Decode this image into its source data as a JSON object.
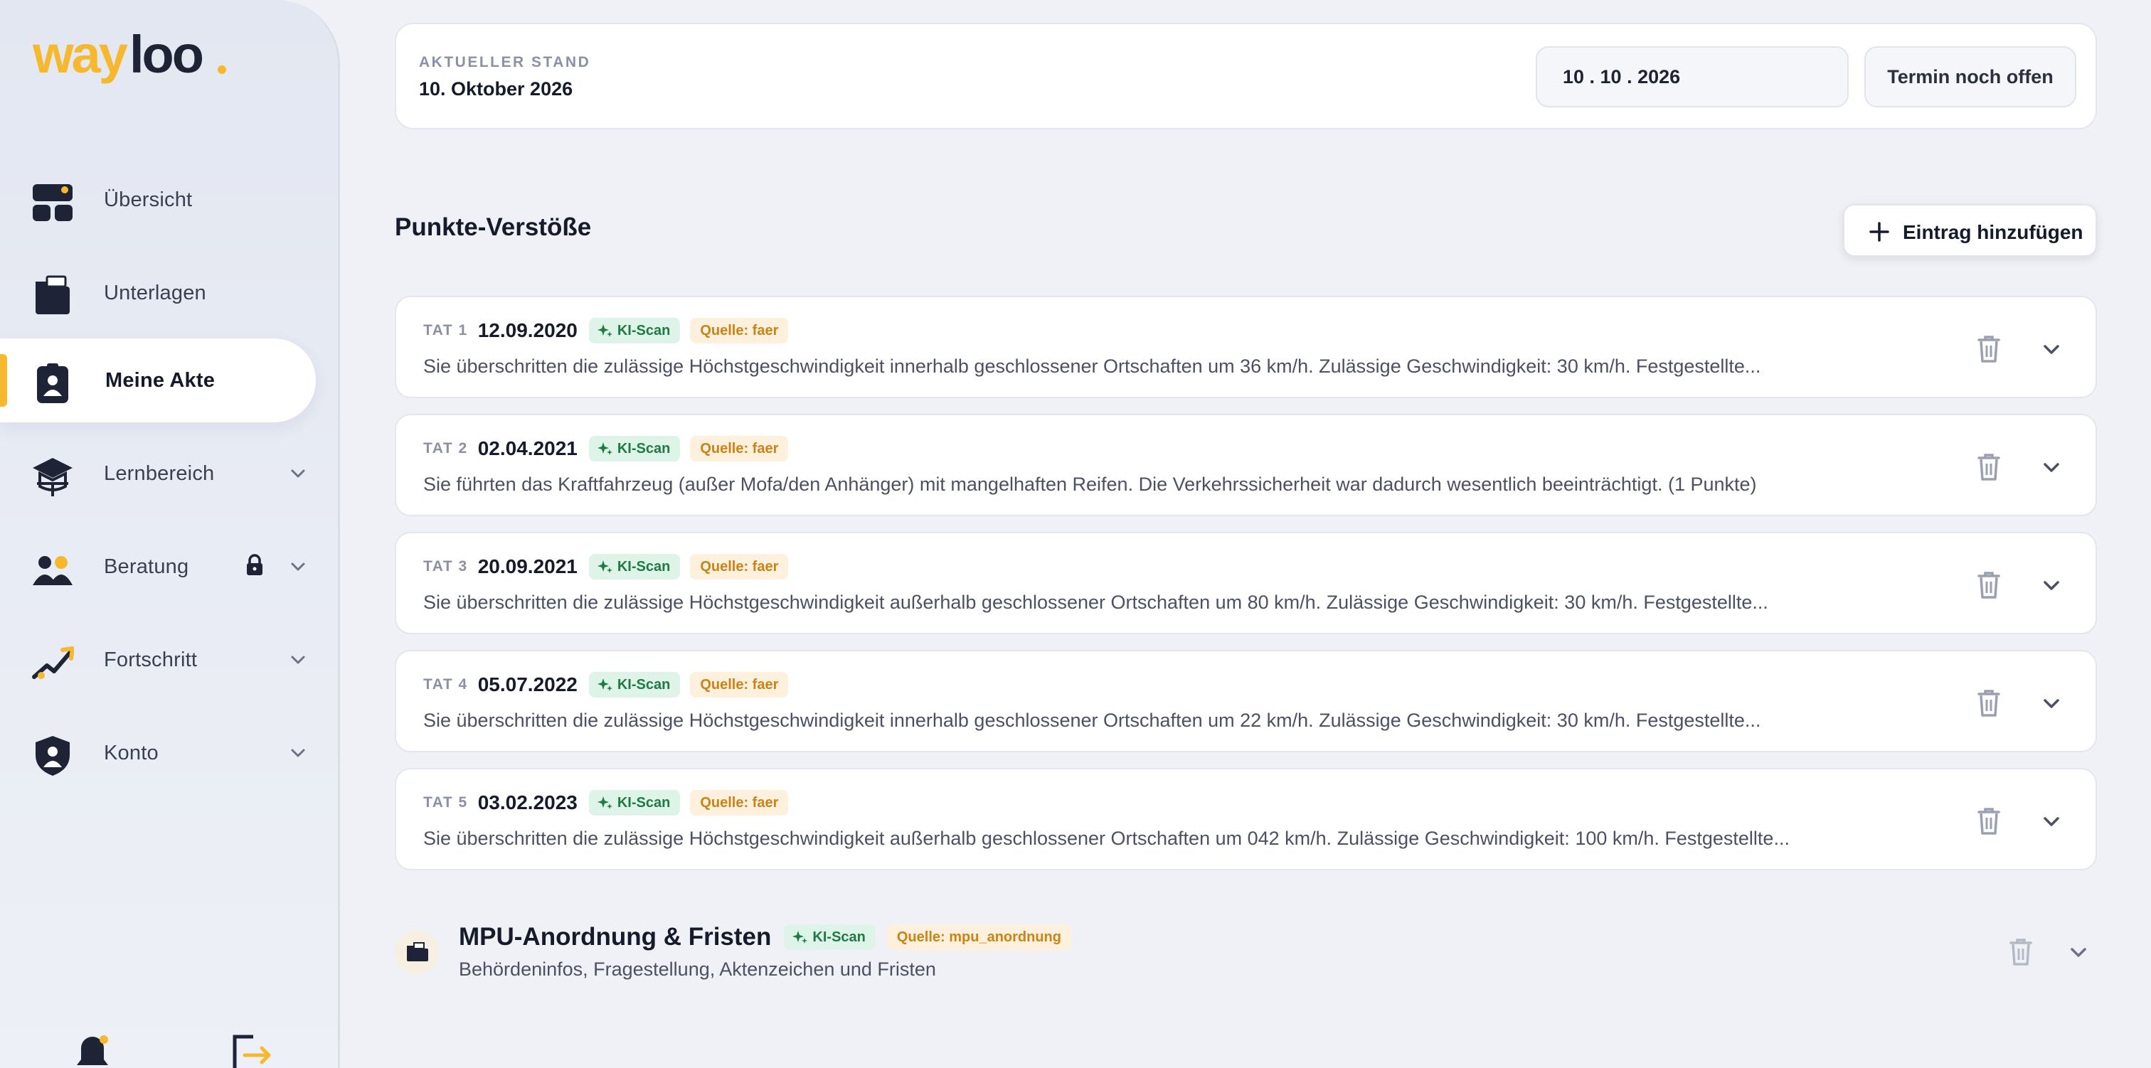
{
  "brand": {
    "logo_text": "wayloo.",
    "accent_color": "#f5b82e",
    "dark_color": "#1e2435"
  },
  "sidebar": {
    "items": [
      {
        "label": "Übersicht",
        "icon": "dashboard-icon"
      },
      {
        "label": "Unterlagen",
        "icon": "folder-icon"
      },
      {
        "label": "Meine Akte",
        "icon": "id-badge-icon",
        "active": true
      },
      {
        "label": "Lernbereich",
        "icon": "graduation-cap-icon",
        "expandable": true
      },
      {
        "label": "Beratung",
        "icon": "users-icon",
        "expandable": true,
        "locked": true
      },
      {
        "label": "Fortschritt",
        "icon": "progress-trend-icon",
        "expandable": true
      },
      {
        "label": "Konto",
        "icon": "shield-user-icon",
        "expandable": true
      }
    ],
    "bottom": {
      "notifications_icon": "bell-icon",
      "logout_icon": "logout-icon"
    }
  },
  "status": {
    "kicker": "AKTUELLER STAND",
    "date_text": "10. Oktober 2026",
    "date_input_value": "10 . 10 . 2026",
    "open_button_label": "Termin noch offen"
  },
  "violations_section": {
    "title": "Punkte-Verstöße",
    "add_button_label": "Eintrag hinzufügen",
    "ki_badge_label": "KI-Scan",
    "items": [
      {
        "tat": "TAT 1",
        "date": "12.09.2020",
        "source": "Quelle: faer",
        "text": "Sie überschritten die zulässige Höchstgeschwindigkeit innerhalb geschlossener Ortschaften um 36 km/h. Zulässige Geschwindigkeit: 30 km/h. Festgestellte..."
      },
      {
        "tat": "TAT 2",
        "date": "02.04.2021",
        "source": "Quelle: faer",
        "text": "Sie führten das Kraftfahrzeug (außer Mofa/den Anhänger) mit mangelhaften Reifen. Die Verkehrssicherheit war dadurch wesentlich beeinträchtigt. (1 Punkte)"
      },
      {
        "tat": "TAT 3",
        "date": "20.09.2021",
        "source": "Quelle: faer",
        "text": "Sie überschritten die zulässige Höchstgeschwindigkeit außerhalb geschlossener Ortschaften um 80 km/h. Zulässige Geschwindigkeit: 30 km/h. Festgestellte..."
      },
      {
        "tat": "TAT 4",
        "date": "05.07.2022",
        "source": "Quelle: faer",
        "text": "Sie überschritten die zulässige Höchstgeschwindigkeit innerhalb geschlossener Ortschaften um 22 km/h. Zulässige Geschwindigkeit: 30 km/h. Festgestellte..."
      },
      {
        "tat": "TAT 5",
        "date": "03.02.2023",
        "source": "Quelle: faer",
        "text": "Sie überschritten die zulässige Höchstgeschwindigkeit außerhalb geschlossener Ortschaften um 042 km/h. Zulässige Geschwindigkeit: 100 km/h. Festgestellte..."
      }
    ]
  },
  "mpu_section": {
    "title": "MPU-Anordnung & Fristen",
    "ki_badge_label": "KI-Scan",
    "source": "Quelle: mpu_anordnung",
    "subtitle": "Behördeninfos, Fragestellung, Aktenzeichen und Fristen"
  }
}
